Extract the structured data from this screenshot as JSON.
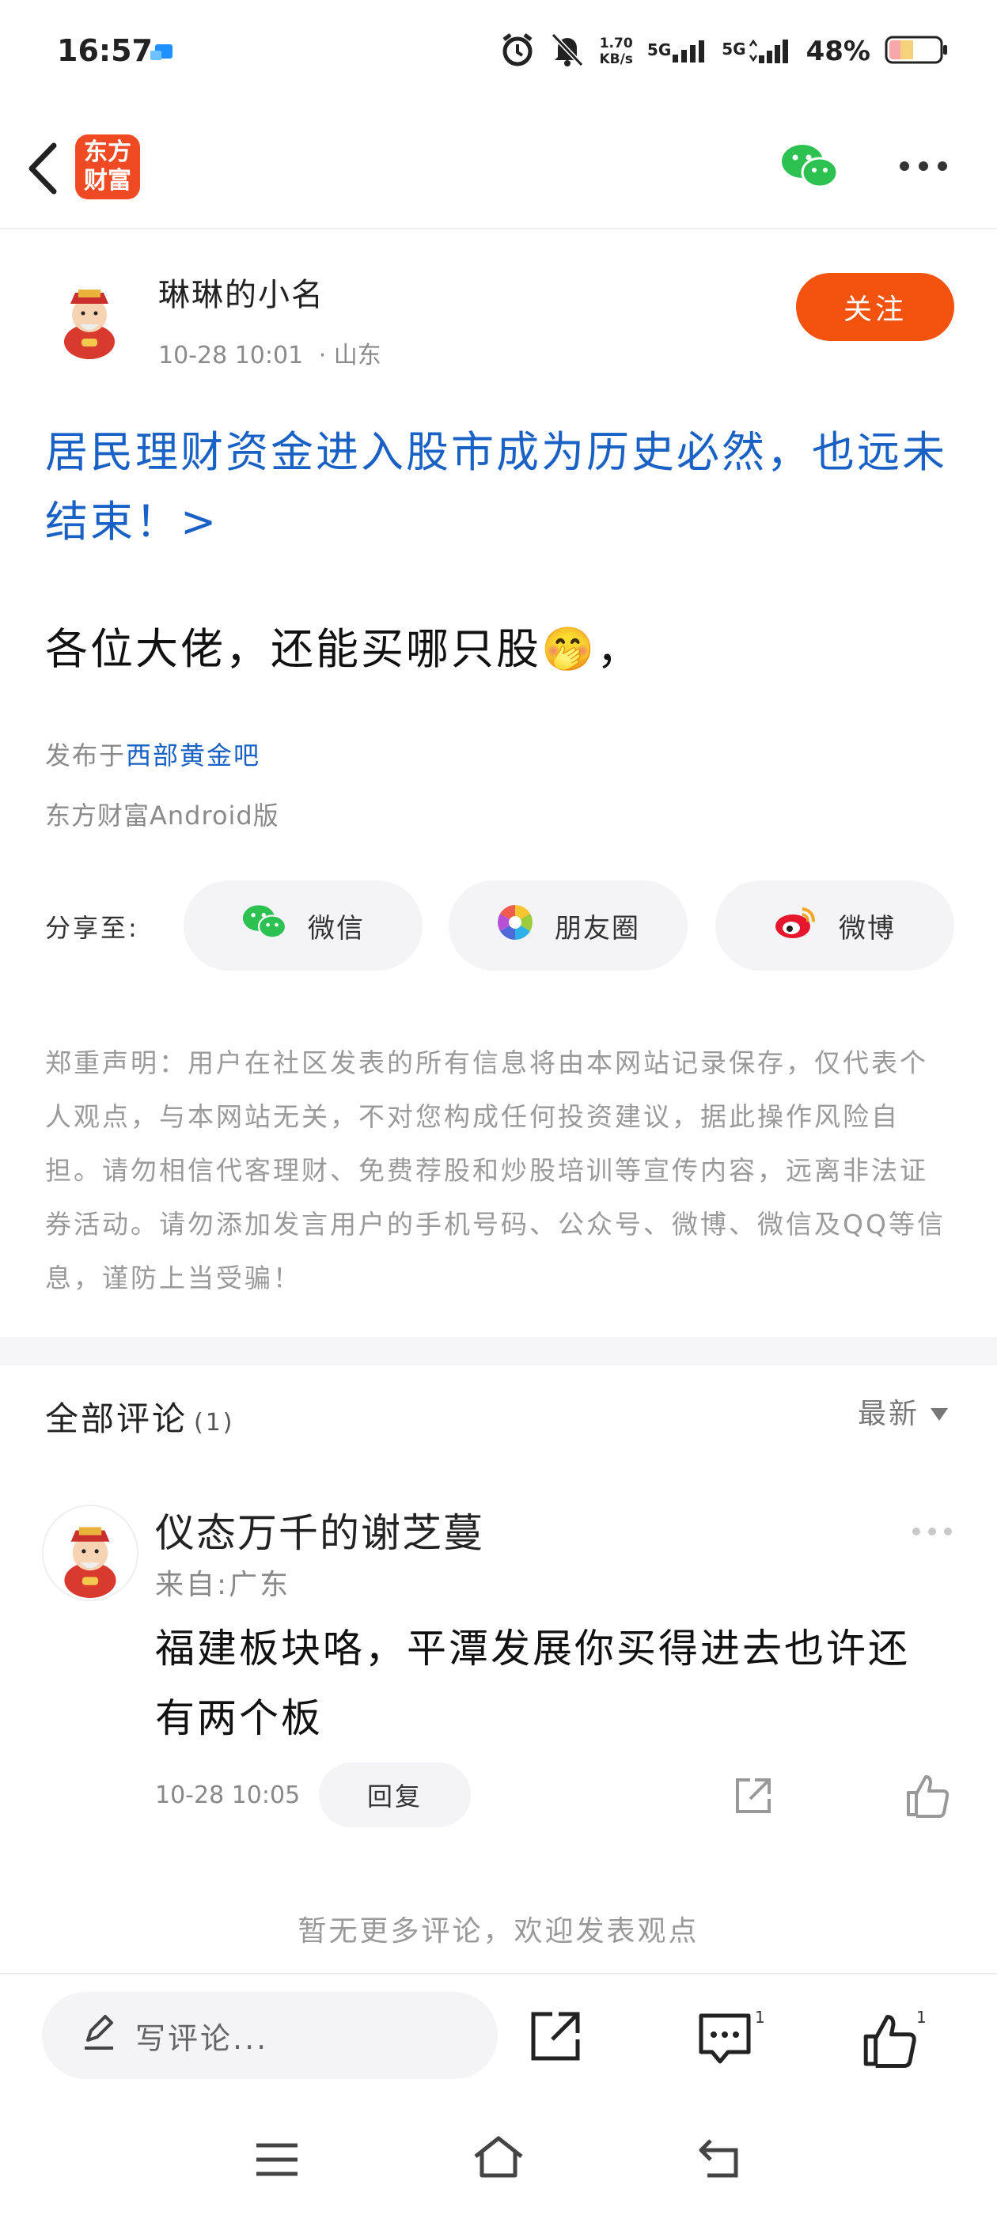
{
  "status_bar": {
    "time": "16:57",
    "net_speed_value": "1.70",
    "net_speed_unit": "KB/s",
    "sim1": "5G",
    "sim2": "5G",
    "battery": "48%"
  },
  "header": {
    "logo_line1": "东方",
    "logo_line2": "财富",
    "share_icon": "wechat-icon",
    "more_icon": "more-dots-icon"
  },
  "post": {
    "author": "琳琳的小名",
    "time": "10-28 10:01",
    "location": "· 山东",
    "follow_label": "关注",
    "headline": "居民理财资金进入股市成为历史必然，也远未结束！>",
    "body": "各位大佬，还能买哪只股🤭，",
    "published_prefix": "发布于",
    "bar_name": "西部黄金吧",
    "client": "东方财富Android版"
  },
  "share": {
    "label": "分享至:",
    "wechat": "微信",
    "moments": "朋友圈",
    "weibo": "微博"
  },
  "disclaimer": "郑重声明：用户在社区发表的所有信息将由本网站记录保存，仅代表个人观点，与本网站无关，不对您构成任何投资建议，据此操作风险自担。请勿相信代客理财、免费荐股和炒股培训等宣传内容，远离非法证券活动。请勿添加发言用户的手机号码、公众号、微博、微信及QQ等信息，谨防上当受骗！",
  "comments": {
    "title": "全部评论",
    "count": "(1)",
    "sort_label": "最新",
    "items": [
      {
        "name": "仪态万千的谢芝蔓",
        "location": "来自:广东",
        "text": "福建板块咯，平潭发展你买得进去也许还有两个板",
        "time": "10-28 10:05",
        "reply_label": "回复"
      }
    ],
    "no_more": "暂无更多评论，欢迎发表观点"
  },
  "bottom": {
    "input_placeholder": "写评论...",
    "comment_count": "1",
    "like_count": "1"
  }
}
